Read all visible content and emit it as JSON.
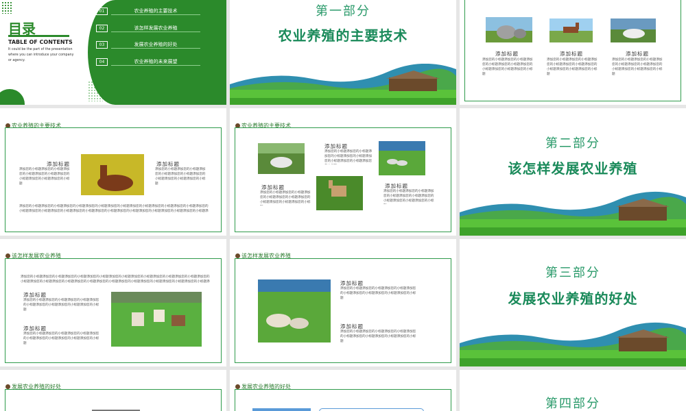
{
  "toc": {
    "title": "目录",
    "subtitle": "TABLE OF CONTENTS",
    "desc": "It could be the part of the presentation where you can introduce your company or agency.",
    "items": [
      {
        "num": "01",
        "text": "农业养殖的主要技术"
      },
      {
        "num": "02",
        "text": "该怎样发展农业养殖"
      },
      {
        "num": "03",
        "text": "发展农业养殖的好处"
      },
      {
        "num": "04",
        "text": "农业养殖的未来展望"
      }
    ]
  },
  "sections": [
    {
      "num": "第一部分",
      "title": "农业养殖的主要技术"
    },
    {
      "num": "第二部分",
      "title": "该怎样发展农业养殖"
    },
    {
      "num": "第三部分",
      "title": "发展农业养殖的好处"
    },
    {
      "num": "第四部分"
    }
  ],
  "labels": {
    "s1": "农业养殖的主要技术",
    "s2": "该怎样发展农业养殖",
    "s3": "发展农业养殖的好处"
  },
  "heading": "添加标题",
  "body_short": "添加您的小标题添加您的小标题添加您的小标题添加您的小标题添加您的小标题添加您的小标题添加您的小标题",
  "body_long": "添加您的小标题添加您的小标题添加您的小标题添加您的小标题添加您的小标题添加您的小标题添加您的小标题添加您的小标题添加您的小标题添加您的小标题添加您的小标题添加您的小标题添加您的小标题添加您的小标题添加您的小标题添加您的小标题添加您的小标题添加您的小标题添加您的小标题添加您的小标题添加您的小标题添加您的小标题",
  "colors": {
    "accent": "#2b8a2b",
    "teal": "#1a8a5a",
    "frame": "#2e9a4a"
  }
}
